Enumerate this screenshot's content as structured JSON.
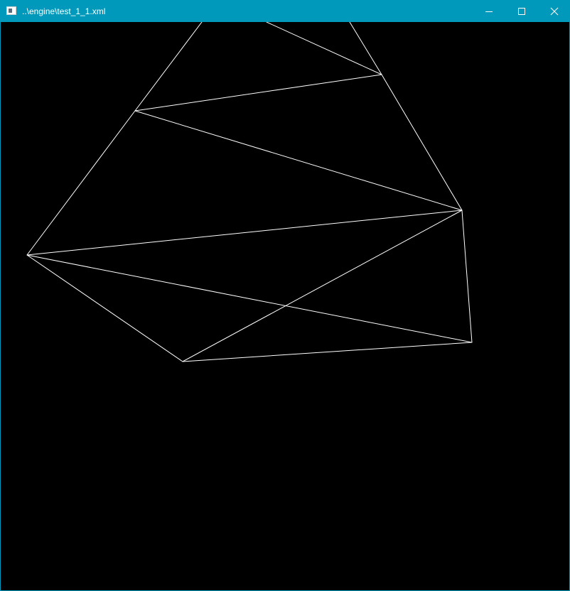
{
  "window": {
    "title": "..\\engine\\test_1_1.xml",
    "accent_color": "#0099bc",
    "icons": {
      "app": "app-window-icon",
      "minimize": "minimize-icon",
      "maximize": "maximize-icon",
      "close": "close-icon"
    }
  },
  "scene": {
    "background": "#000000",
    "line_color": "#ffffff",
    "render_mode": "wireframe"
  }
}
